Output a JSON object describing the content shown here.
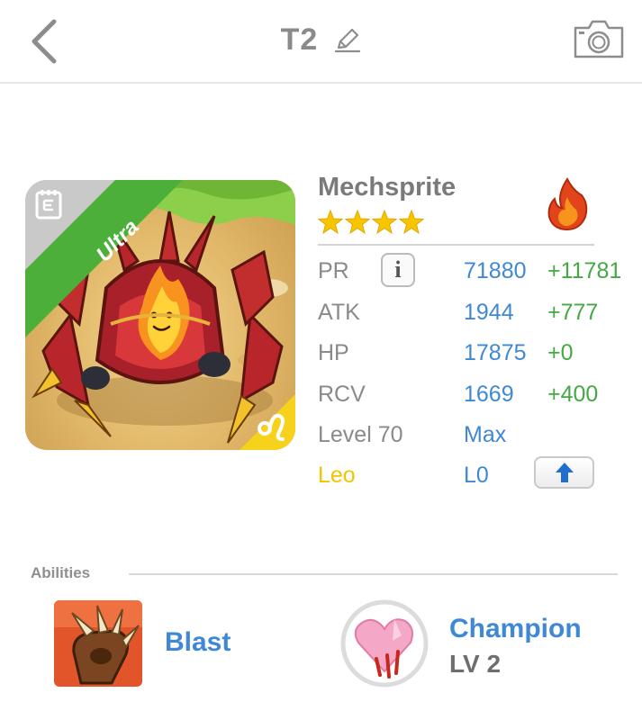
{
  "header": {
    "title": "T2",
    "back_icon": "chevron-left-icon",
    "edit_icon": "pencil-icon",
    "camera_icon": "camera-icon"
  },
  "monster": {
    "name": "Mechsprite",
    "stars": 4,
    "rarity": "Ultra",
    "element_icon": "fire-icon",
    "sign_icon": "leo-zodiac-icon",
    "colors": {
      "rarity_ribbon": "#4caf3a",
      "stat_value": "#3f88d6",
      "stat_bonus": "#44a844",
      "sign": "#f2c500",
      "star": "#f7c600"
    }
  },
  "stats": {
    "pr": {
      "label": "PR",
      "value": "71880",
      "bonus": "+11781"
    },
    "atk": {
      "label": "ATK",
      "value": "1944",
      "bonus": "+777"
    },
    "hp": {
      "label": "HP",
      "value": "17875",
      "bonus": "+0"
    },
    "rcv": {
      "label": "RCV",
      "value": "1669",
      "bonus": "+400"
    },
    "level": {
      "label": "Level 70",
      "value": "Max"
    },
    "sign": {
      "label": "Leo",
      "value": "L0"
    }
  },
  "abilities": {
    "heading": "Abilities",
    "items": [
      {
        "name": "Blast",
        "icon": "claw-icon"
      },
      {
        "name": "Champion",
        "level": "LV 2",
        "icon": "broken-heart-icon"
      }
    ]
  }
}
